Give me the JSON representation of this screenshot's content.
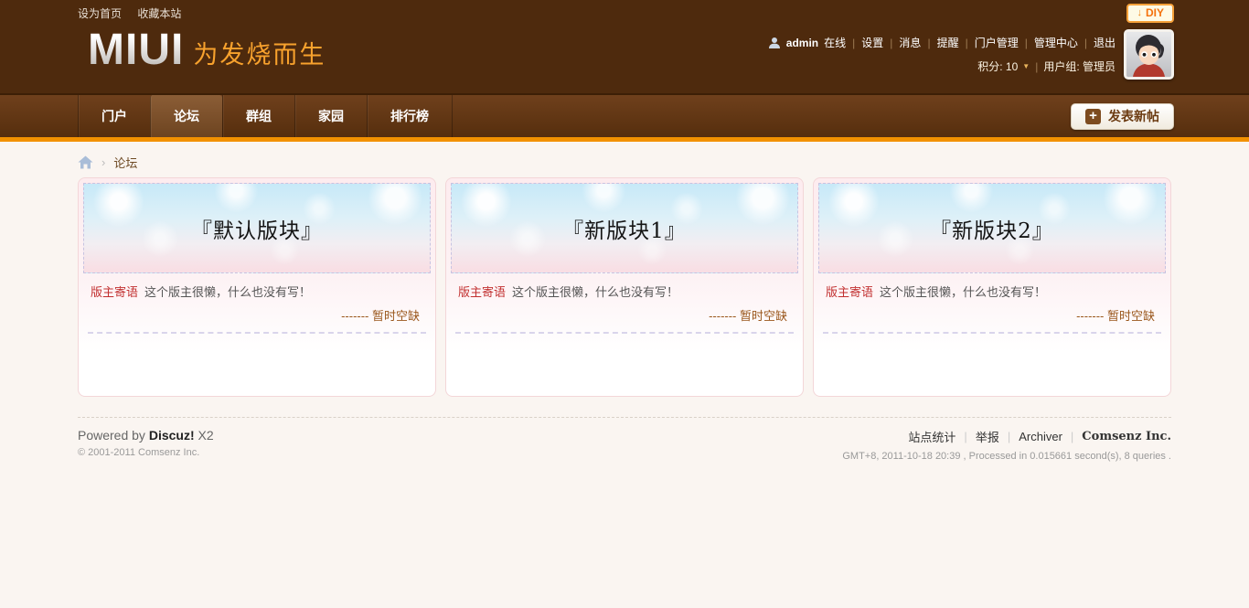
{
  "misc": {
    "sep": "|",
    "crumb_sep": "›",
    "caret": "▼",
    "plus": "+",
    "diy_arrow": "↓"
  },
  "topbar": {
    "set_home": "设为首页",
    "add_favorite": "收藏本站",
    "diy": "DIY"
  },
  "header": {
    "logo": "MIUI",
    "slogan": "为发烧而生",
    "user": {
      "name": "admin",
      "status": "在线",
      "links": [
        "设置",
        "消息",
        "提醒",
        "门户管理",
        "管理中心",
        "退出"
      ],
      "credits": "积分: 10",
      "group": "用户组: 管理员"
    }
  },
  "nav": {
    "tabs": [
      {
        "label": "门户"
      },
      {
        "label": "论坛"
      },
      {
        "label": "群组"
      },
      {
        "label": "家园"
      },
      {
        "label": "排行榜"
      }
    ],
    "active_index": 1,
    "new_post": "发表新帖"
  },
  "breadcrumb": {
    "current": "论坛"
  },
  "forums": [
    {
      "title": "『默认版块』",
      "note_label": "版主寄语",
      "note": "这个版主很懒，什么也没有写！",
      "vacancy": "------- 暂时空缺"
    },
    {
      "title": "『新版块1』",
      "note_label": "版主寄语",
      "note": "这个版主很懒，什么也没有写！",
      "vacancy": "------- 暂时空缺"
    },
    {
      "title": "『新版块2』",
      "note_label": "版主寄语",
      "note": "这个版主很懒，什么也没有写！",
      "vacancy": "------- 暂时空缺"
    }
  ],
  "footer": {
    "powered_prefix": "Powered by",
    "product": "Discuz!",
    "version": "X2",
    "copyright": "© 2001-2011 Comsenz Inc.",
    "links": [
      "站点统计",
      "举报",
      "Archiver"
    ],
    "company": "Comsenz Inc.",
    "stats": "GMT+8, 2011-10-18 20:39 , Processed in 0.015661 second(s), 8 queries ."
  },
  "colors": {
    "header_bg": "#4e2a0d",
    "nav_orange": "#f29100",
    "slogan_orange": "#f8a22d",
    "card_border": "#f3d6d8",
    "note_red": "#c23030",
    "vacancy_brown": "#9a571c"
  }
}
